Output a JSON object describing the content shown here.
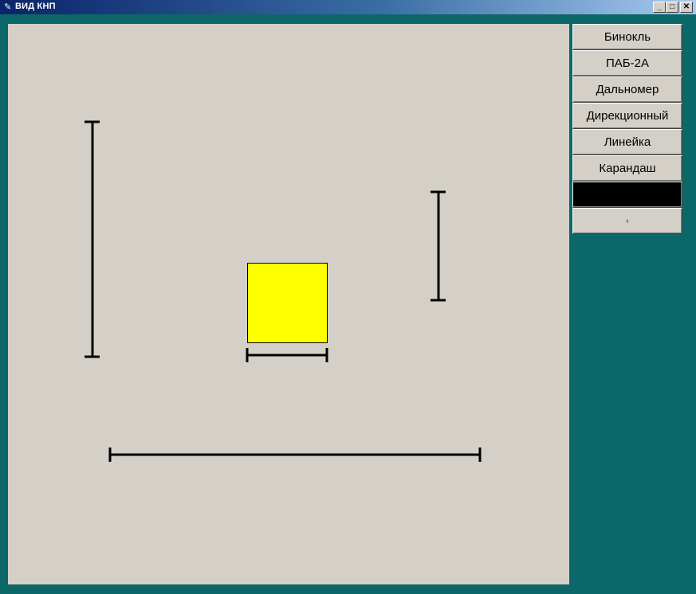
{
  "window": {
    "title": "ВИД КНП",
    "app_icon": "feather-icon",
    "controls": {
      "minimize": "_",
      "maximize": "□",
      "close": "✕"
    }
  },
  "tools": [
    {
      "label": "Бинокль",
      "name": "binoculars"
    },
    {
      "label": "ПАБ-2А",
      "name": "pab-2a"
    },
    {
      "label": "Дальномер",
      "name": "rangefinder"
    },
    {
      "label": "Дирекционный",
      "name": "directional"
    },
    {
      "label": "Линейка",
      "name": "ruler"
    },
    {
      "label": "Карандаш",
      "name": "pencil"
    },
    {
      "label": "",
      "name": "color-swatch",
      "color": "#000000"
    },
    {
      "label": "‹",
      "name": "arrow"
    }
  ],
  "scene": {
    "target_fill": "#ffff00",
    "line_color": "#000000",
    "background": "#d4d0c8"
  }
}
